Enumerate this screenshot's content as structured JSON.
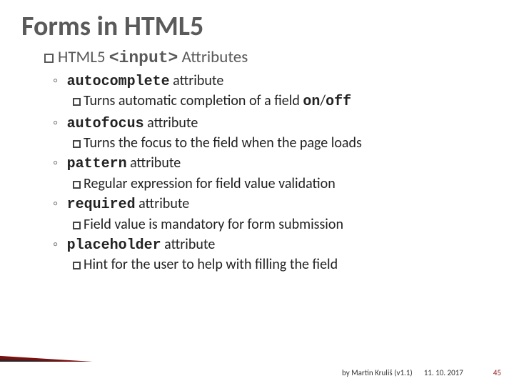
{
  "title": "Forms in HTML5",
  "subtitle": {
    "prefix": "HTML5 ",
    "code": "<input>",
    "suffix": " Attributes"
  },
  "items": [
    {
      "code": "autocomplete",
      "label_suffix": " attribute",
      "desc_pre": "Turns automatic completion of a field ",
      "desc_code1": "on",
      "desc_mid": "/",
      "desc_code2": "off",
      "desc_post": ""
    },
    {
      "code": "autofocus",
      "label_suffix": " attribute",
      "desc_pre": "Turns the focus to the field when the page loads",
      "desc_code1": "",
      "desc_mid": "",
      "desc_code2": "",
      "desc_post": ""
    },
    {
      "code": "pattern",
      "label_suffix": " attribute",
      "desc_pre": "Regular expression for field value validation",
      "desc_code1": "",
      "desc_mid": "",
      "desc_code2": "",
      "desc_post": ""
    },
    {
      "code": "required",
      "label_suffix": " attribute",
      "desc_pre": "Field value is mandatory for form submission",
      "desc_code1": "",
      "desc_mid": "",
      "desc_code2": "",
      "desc_post": ""
    },
    {
      "code": "placeholder",
      "label_suffix": " attribute",
      "desc_pre": "Hint for the user to help with filling the field",
      "desc_code1": "",
      "desc_mid": "",
      "desc_code2": "",
      "desc_post": ""
    }
  ],
  "footer": {
    "author": "by Martin Kruliš (v1.1)",
    "date": "11. 10. 2017",
    "page": "45"
  }
}
